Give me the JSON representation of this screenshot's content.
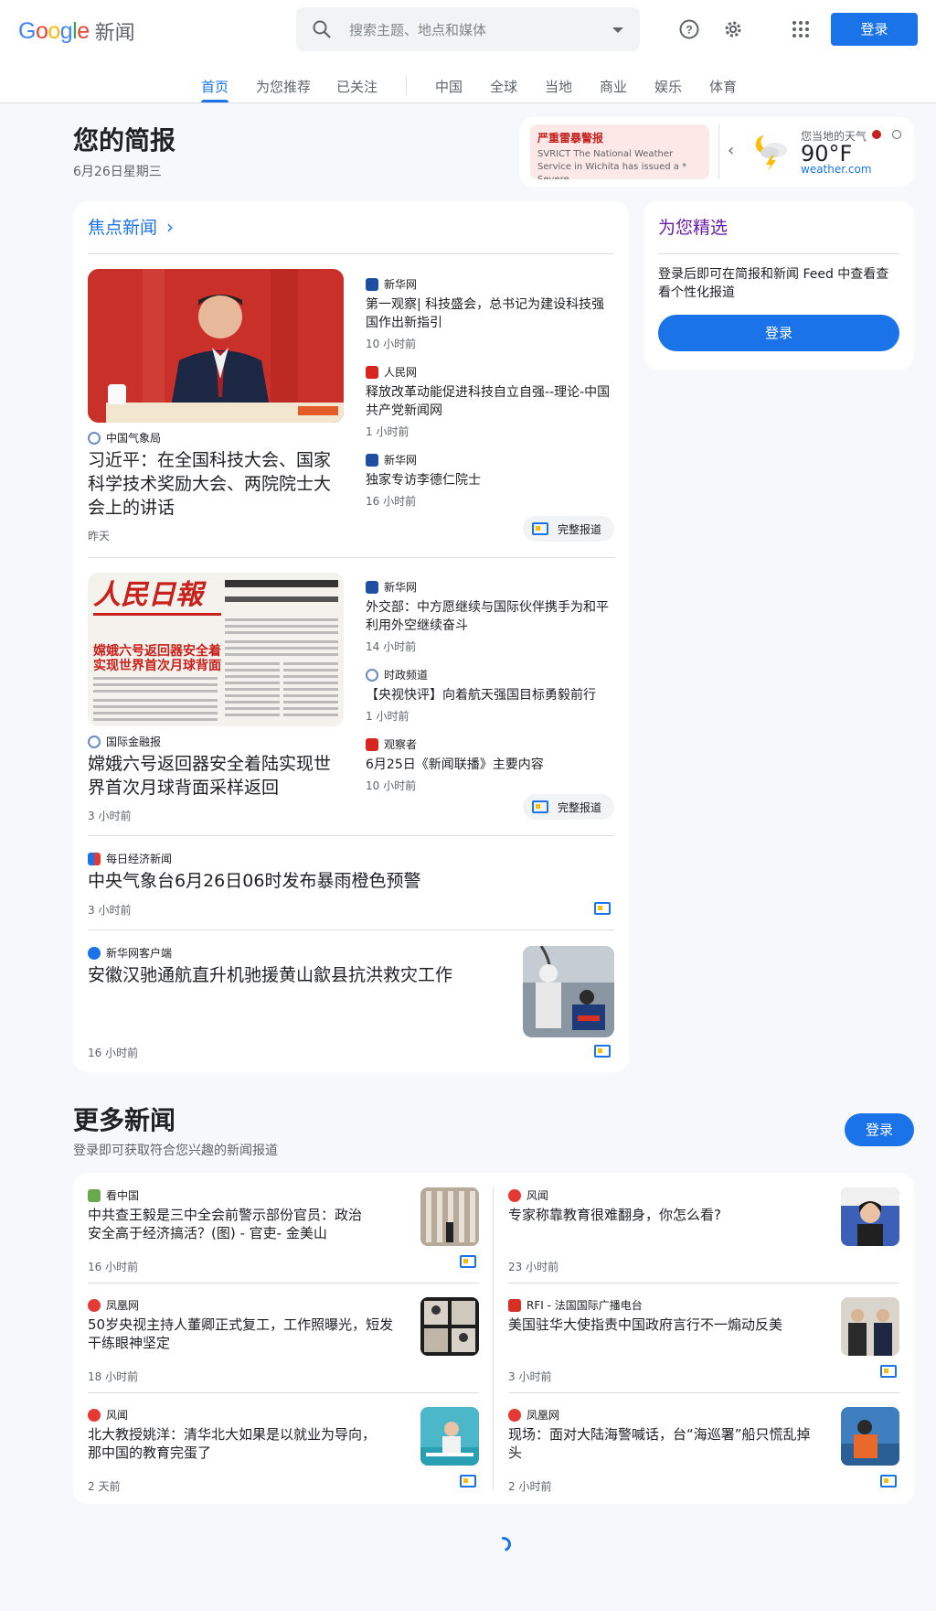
{
  "header": {
    "logo_google": "Google",
    "logo_news": "新闻",
    "search_placeholder": "搜索主题、地点和媒体",
    "login_label": "登录",
    "nav": [
      "首页",
      "为您推荐",
      "已关注",
      "中国",
      "全球",
      "当地",
      "商业",
      "娱乐",
      "体育"
    ],
    "active_nav": "首页"
  },
  "briefing": {
    "title": "您的简报",
    "date": "6月26日星期三"
  },
  "weather": {
    "alert_title": "严重雷暴警报",
    "alert_text": "SVRICT The National Weather Service in Wichita has issued a * Severe…",
    "label": "您当地的天气",
    "temp": "90°F",
    "source": "weather.com"
  },
  "top_stories": {
    "title": "焦点新闻",
    "cluster1": {
      "main_source": "中国气象局",
      "main_headline": "习近平：在全国科技大会、国家科学技术奖励大会、两院院士大会上的讲话",
      "main_time": "昨天",
      "items": [
        {
          "source": "新华网",
          "title": "第一观察| 科技盛会，总书记为建设科技强国作出新指引",
          "time": "10 小时前"
        },
        {
          "source": "人民网",
          "title": "释放改革动能促进科技自立自强--理论-中国共产党新闻网",
          "time": "1 小时前"
        },
        {
          "source": "新华网",
          "title": "独家专访李德仁院士",
          "time": "16 小时前"
        }
      ],
      "full_coverage": "完整报道"
    },
    "cluster2": {
      "main_source": "国际金融报",
      "main_headline": "嫦娥六号返回器安全着陆实现世界首次月球背面采样返回",
      "main_time": "3 小时前",
      "items": [
        {
          "source": "新华网",
          "title": "外交部：中方愿继续与国际伙伴携手为和平利用外空继续奋斗",
          "time": "14 小时前"
        },
        {
          "source": "时政频道",
          "title": "【央视快评】向着航天强国目标勇毅前行",
          "time": "1 小时前"
        },
        {
          "source": "观察者",
          "title": "6月25日《新闻联播》主要内容",
          "time": "10 小时前"
        }
      ],
      "full_coverage": "完整报道"
    },
    "story3": {
      "source": "每日经济新闻",
      "title": "中央气象台6月26日06时发布暴雨橙色预警",
      "time": "3 小时前"
    },
    "story4": {
      "source": "新华网客户端",
      "title": "安徽汉驰通航直升机驰援黄山歙县抗洪救灾工作",
      "time": "16 小时前"
    }
  },
  "for_you": {
    "title": "为您精选",
    "text": "登录后即可在简报和新闻 Feed 中查看查看个性化报道",
    "button": "登录"
  },
  "more_news": {
    "title": "更多新闻",
    "subtitle": "登录即可获取符合您兴趣的新闻报道",
    "button": "登录",
    "left": [
      {
        "source": "看中国",
        "title": "中共查王毅是三中全会前警示部份官员：政治安全高于经济搞活？(图) - 官吏- 金美山",
        "time": "16 小时前"
      },
      {
        "source": "凤凰网",
        "title": "50岁央视主持人董卿正式复工，工作照曝光，短发干练眼神坚定",
        "time": "18 小时前"
      },
      {
        "source": "风闻",
        "title": "北大教授姚洋：清华北大如果是以就业为导向，那中国的教育完蛋了",
        "time": "2 天前"
      }
    ],
    "right": [
      {
        "source": "风闻",
        "title": "专家称靠教育很难翻身，你怎么看?",
        "time": "23 小时前"
      },
      {
        "source": "RFI - 法国国际广播电台",
        "title": "美国驻华大使指责中国政府言行不一煽动反美",
        "time": "3 小时前"
      },
      {
        "source": "凤凰网",
        "title": "现场：面对大陆海警喊话，台“海巡署”船只慌乱掉头",
        "time": "2 小时前"
      }
    ]
  },
  "colors": {
    "accent": "#1a73e8",
    "purple_title": "#681da8",
    "alert_bg": "#fce8e6"
  }
}
